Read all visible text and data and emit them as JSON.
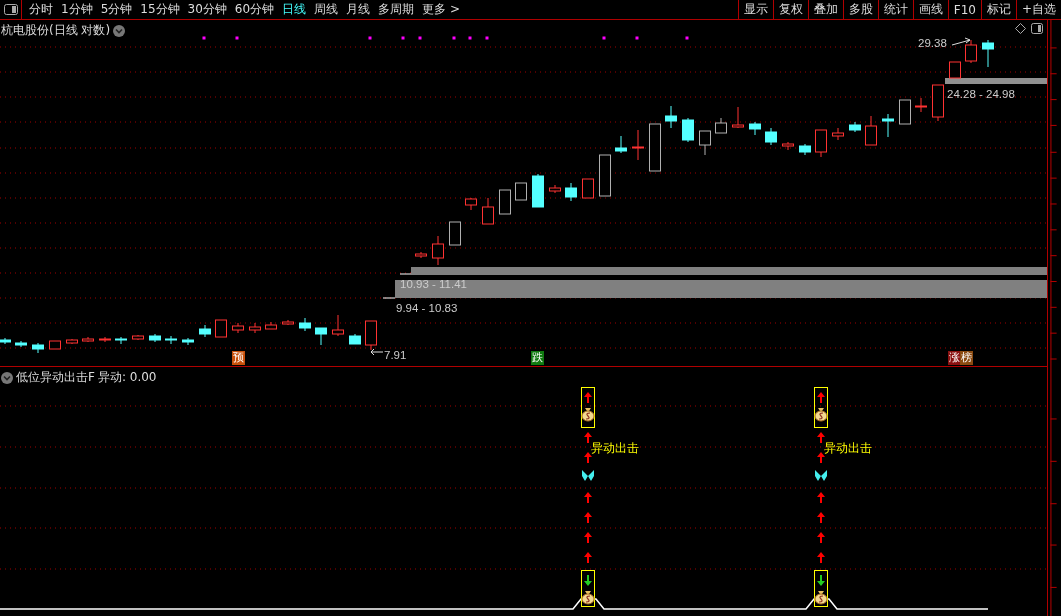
{
  "toolbar": {
    "periods": [
      {
        "label": "分时",
        "selected": false
      },
      {
        "label": "1分钟",
        "selected": false
      },
      {
        "label": "5分钟",
        "selected": false
      },
      {
        "label": "15分钟",
        "selected": false
      },
      {
        "label": "30分钟",
        "selected": false
      },
      {
        "label": "60分钟",
        "selected": false
      },
      {
        "label": "日线",
        "selected": true
      },
      {
        "label": "周线",
        "selected": false
      },
      {
        "label": "月线",
        "selected": false
      },
      {
        "label": "多周期",
        "selected": false
      },
      {
        "label": "更多 >",
        "selected": false
      }
    ],
    "tools": [
      "显示",
      "复权",
      "叠加",
      "多股",
      "统计",
      "画线",
      "F10",
      "标记",
      "+自选"
    ]
  },
  "main_chart": {
    "title": "杭电股份(日线 对数)",
    "price_labels": [
      "29.38",
      "24.28 - 24.98",
      "10.93 - 11.41",
      "9.94 - 10.83",
      "7.91"
    ],
    "signal_tags": [
      {
        "text": "预",
        "color": "#c8500a"
      },
      {
        "text": "跌",
        "color": "#107a10"
      },
      {
        "text": "涨",
        "color": "#8a1010"
      },
      {
        "text": "榜",
        "color": "#8a4a10"
      }
    ]
  },
  "indicator": {
    "name": "低位异动出击F",
    "reading": "异动: 0.00",
    "signals": [
      {
        "label": "异动出击"
      },
      {
        "label": "异动出击"
      }
    ]
  }
}
